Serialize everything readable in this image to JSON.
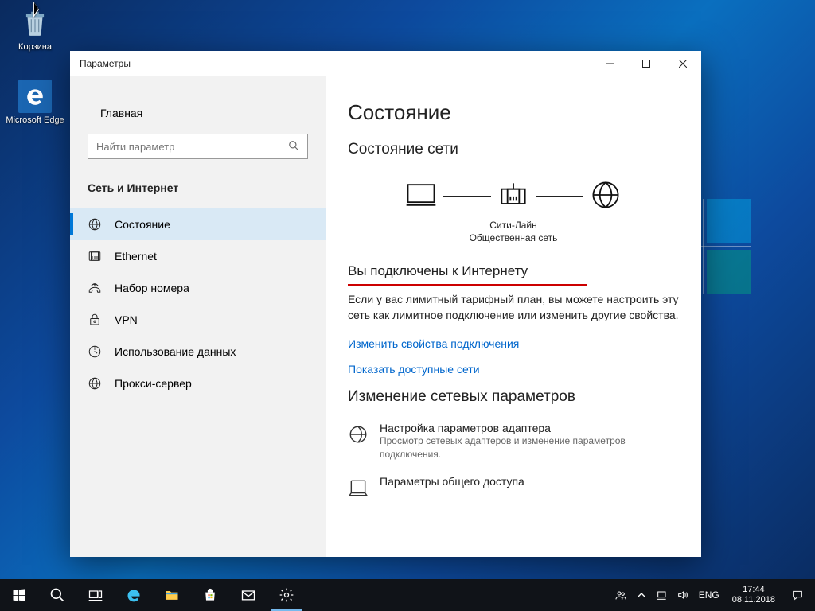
{
  "desktop": {
    "recycle_label": "Корзина",
    "edge_label": "Microsoft Edge"
  },
  "window": {
    "title": "Параметры"
  },
  "sidebar": {
    "home": "Главная",
    "search_placeholder": "Найти параметр",
    "section": "Сеть и Интернет",
    "items": [
      {
        "label": "Состояние"
      },
      {
        "label": "Ethernet"
      },
      {
        "label": "Набор номера"
      },
      {
        "label": "VPN"
      },
      {
        "label": "Использование данных"
      },
      {
        "label": "Прокси-сервер"
      }
    ]
  },
  "content": {
    "h1": "Состояние",
    "h2_status": "Состояние сети",
    "net_name": "Сити-Лайн",
    "net_type": "Общественная сеть",
    "connected_heading": "Вы подключены к Интернету",
    "connected_body": "Если у вас лимитный тарифный план, вы можете настроить эту сеть как лимитное подключение или изменить другие свойства.",
    "link_change": "Изменить свойства подключения",
    "link_show": "Показать доступные сети",
    "h2_change": "Изменение сетевых параметров",
    "adapter_title": "Настройка параметров адаптера",
    "adapter_sub": "Просмотр сетевых адаптеров и изменение параметров подключения.",
    "sharing_title": "Параметры общего доступа"
  },
  "taskbar": {
    "lang": "ENG",
    "time": "17:44",
    "date": "08.11.2018"
  }
}
